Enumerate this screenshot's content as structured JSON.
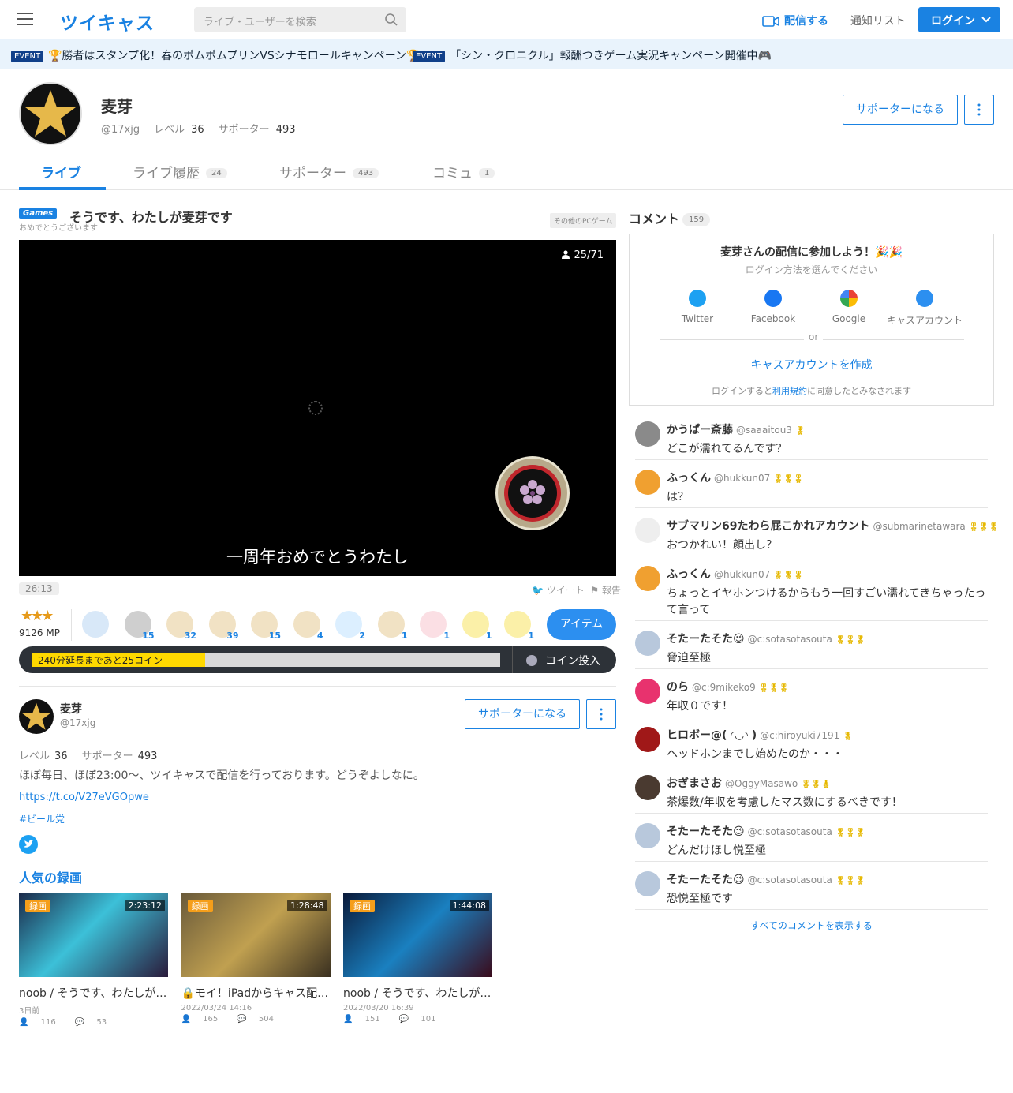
{
  "header": {
    "logo": "ツイキャス",
    "search_placeholder": "ライブ・ユーザーを検索",
    "broadcast": "配信する",
    "notify": "通知リスト",
    "login": "ログイン"
  },
  "events": [
    {
      "tag": "EVENT",
      "text": "🏆勝者はスタンプ化！春のポムポムプリンVSシナモロールキャンペーン🏆"
    },
    {
      "tag": "EVENT",
      "text": "「シン・クロニクル」報酬つきゲーム実況キャンペーン開催中🎮"
    }
  ],
  "profile": {
    "name": "麦芽",
    "id": "@17xjg",
    "level_label": "レベル",
    "level": "36",
    "supporter_label": "サポーター",
    "supporters": "493",
    "support_btn": "サポーターになる"
  },
  "tabs": [
    {
      "label": "ライブ",
      "count": ""
    },
    {
      "label": "ライブ履歴",
      "count": "24"
    },
    {
      "label": "サポーター",
      "count": "493"
    },
    {
      "label": "コミュ",
      "count": "1"
    }
  ],
  "live": {
    "category_tag": "Games",
    "title": "そうです、わたしが麦芽です",
    "subtitle": "おめでとうございます",
    "category": "その他のPCゲーム",
    "viewers": "25/71",
    "caption": "一周年おめでとうわたし",
    "time": "26:13",
    "tweet": "ツイート",
    "report": "報告"
  },
  "rating": {
    "stars": "★★★",
    "mp": "9126 MP"
  },
  "gifts": [
    {
      "icon": "smile-icon",
      "count": "",
      "color": "#d8e8f8"
    },
    {
      "icon": "coin-icon",
      "count": "15",
      "color": "#cfcfcf"
    },
    {
      "icon": "tea-icon",
      "count": "32",
      "color": "#f1e2c4"
    },
    {
      "icon": "tea-icon",
      "count": "39",
      "color": "#f1e2c4"
    },
    {
      "icon": "tea-icon",
      "count": "15",
      "color": "#f1e2c4"
    },
    {
      "icon": "tea-icon",
      "count": "4",
      "color": "#f1e2c4"
    },
    {
      "icon": "cinnamoroll-icon",
      "count": "2",
      "color": "#dcefff"
    },
    {
      "icon": "tea-icon",
      "count": "1",
      "color": "#f1e2c4"
    },
    {
      "icon": "bunny-icon",
      "count": "1",
      "color": "#fbdfe4"
    },
    {
      "icon": "chick-icon",
      "count": "1",
      "color": "#fbf0a8"
    },
    {
      "icon": "chick-icon",
      "count": "1",
      "color": "#fbf0a8"
    }
  ],
  "item_btn": "アイテム",
  "coin": {
    "text": "240分延長まであと25コイン",
    "progress": 0.37,
    "button": "コイン投入"
  },
  "about": {
    "name": "麦芽",
    "id": "@17xjg",
    "level_label": "レベル",
    "level": "36",
    "supporter_label": "サポーター",
    "supporters": "493",
    "support_btn": "サポーターになる",
    "description": "ほぼ毎日、ほぼ23:00〜、ツイキャスで配信を行っております。どうぞよしなに。",
    "link": "https://t.co/V27eVGOpwe",
    "hashtag": "#ビール党"
  },
  "popular": {
    "title": "人気の録画",
    "items": [
      {
        "tag": "録画",
        "duration": "2:23:12",
        "title": "noob / そうです、わたしが麦芽です",
        "date": "3日前",
        "views": "116",
        "comments": "53",
        "lock": ""
      },
      {
        "tag": "録画",
        "duration": "1:28:48",
        "title": "モイ！iPadからキャス配信中",
        "date": "2022/03/24 14:16",
        "views": "165",
        "comments": "504",
        "lock": "🔒"
      },
      {
        "tag": "録画",
        "duration": "1:44:08",
        "title": "noob / そうです、わたしが麦芽です",
        "date": "2022/03/20 16:39",
        "views": "151",
        "comments": "101",
        "lock": ""
      }
    ]
  },
  "comments_panel": {
    "title": "コメント",
    "count": "159",
    "join_title": "麦芽さんの配信に参加しよう！🎉🎉",
    "join_sub": "ログイン方法を選んでください",
    "socials": [
      "Twitter",
      "Facebook",
      "Google",
      "キャスアカウント"
    ],
    "or": "or",
    "create": "キャスアカウントを作成",
    "terms_pre": "ログインすると",
    "terms_link": "利用規約",
    "terms_post": "に同意したとみなされます",
    "show_all": "すべてのコメントを表示する"
  },
  "comments": [
    {
      "name": "かうぱー斎藤",
      "id": "@saaaitou3",
      "stars": "🎖",
      "text": "どこが濡れてるんです？",
      "avatar": "#8a8a8a"
    },
    {
      "name": "ふっくん",
      "id": "@hukkun07",
      "stars": "🎖🎖🎖",
      "text": "は？",
      "avatar": "#f0a030"
    },
    {
      "name": "サブマリン69たわら屁こかれアカウント",
      "id": "@submarinetawara",
      "stars": "🎖🎖🎖",
      "text": "おつかれい！顔出し？",
      "avatar": "#eeeeee"
    },
    {
      "name": "ふっくん",
      "id": "@hukkun07",
      "stars": "🎖🎖🎖",
      "text": "ちょっとイヤホンつけるからもう一回すごい濡れてきちゃったって言って",
      "avatar": "#f0a030"
    },
    {
      "name": "そたーたそた😉",
      "id": "@c:sotasotasouta",
      "stars": "🎖🎖🎖",
      "text": "脅迫至極",
      "avatar": "#b8c8dc"
    },
    {
      "name": "のら",
      "id": "@c:9mikeko9",
      "stars": "🎖🎖🎖",
      "text": "年収０です！",
      "avatar": "#e8326e"
    },
    {
      "name": "ヒロボー@( ◜◡◝ )",
      "id": "@c:hiroyuki7191",
      "stars": "🎖",
      "text": "ヘッドホンまでし始めたのか・・・",
      "avatar": "#a01818"
    },
    {
      "name": "おぎまさお",
      "id": "@OggyMasawo",
      "stars": "🎖🎖🎖",
      "text": "茶爆数/年収を考慮したマス数にするべきです！",
      "avatar": "#4a3a30"
    },
    {
      "name": "そたーたそた😉",
      "id": "@c:sotasotasouta",
      "stars": "🎖🎖🎖",
      "text": "どんだけほし悦至極",
      "avatar": "#b8c8dc"
    },
    {
      "name": "そたーたそた😉",
      "id": "@c:sotasotasouta",
      "stars": "🎖🎖🎖",
      "text": "恐悦至極です",
      "avatar": "#b8c8dc"
    }
  ]
}
